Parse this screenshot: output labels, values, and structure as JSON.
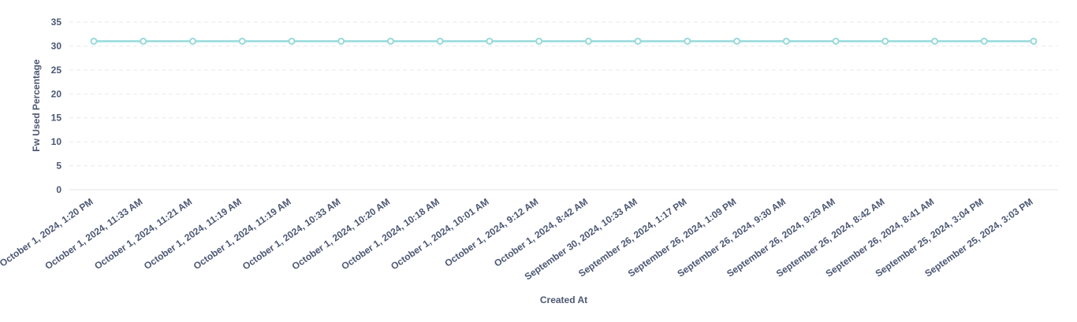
{
  "chart_data": {
    "type": "line",
    "xlabel": "Created At",
    "ylabel": "Fw Used Percentage",
    "ylim": [
      0,
      35
    ],
    "yticks": [
      0,
      5,
      10,
      15,
      20,
      25,
      30,
      35
    ],
    "grid": true,
    "color": "#98d9d9",
    "categories": [
      "October 1, 2024, 1:20 PM",
      "October 1, 2024, 11:33 AM",
      "October 1, 2024, 11:21 AM",
      "October 1, 2024, 11:19 AM",
      "October 1, 2024, 11:19 AM",
      "October 1, 2024, 10:33 AM",
      "October 1, 2024, 10:20 AM",
      "October 1, 2024, 10:18 AM",
      "October 1, 2024, 10:01 AM",
      "October 1, 2024, 9:12 AM",
      "October 1, 2024, 8:42 AM",
      "September 30, 2024, 10:33 AM",
      "September 26, 2024, 1:17 PM",
      "September 26, 2024, 1:09 PM",
      "September 26, 2024, 9:30 AM",
      "September 26, 2024, 9:29 AM",
      "September 26, 2024, 8:42 AM",
      "September 26, 2024, 8:41 AM",
      "September 25, 2024, 3:04 PM",
      "September 25, 2024, 3:03 PM"
    ],
    "values": [
      31,
      31,
      31,
      31,
      31,
      31,
      31,
      31,
      31,
      31,
      31,
      31,
      31,
      31,
      31,
      31,
      31,
      31,
      31,
      31
    ]
  }
}
